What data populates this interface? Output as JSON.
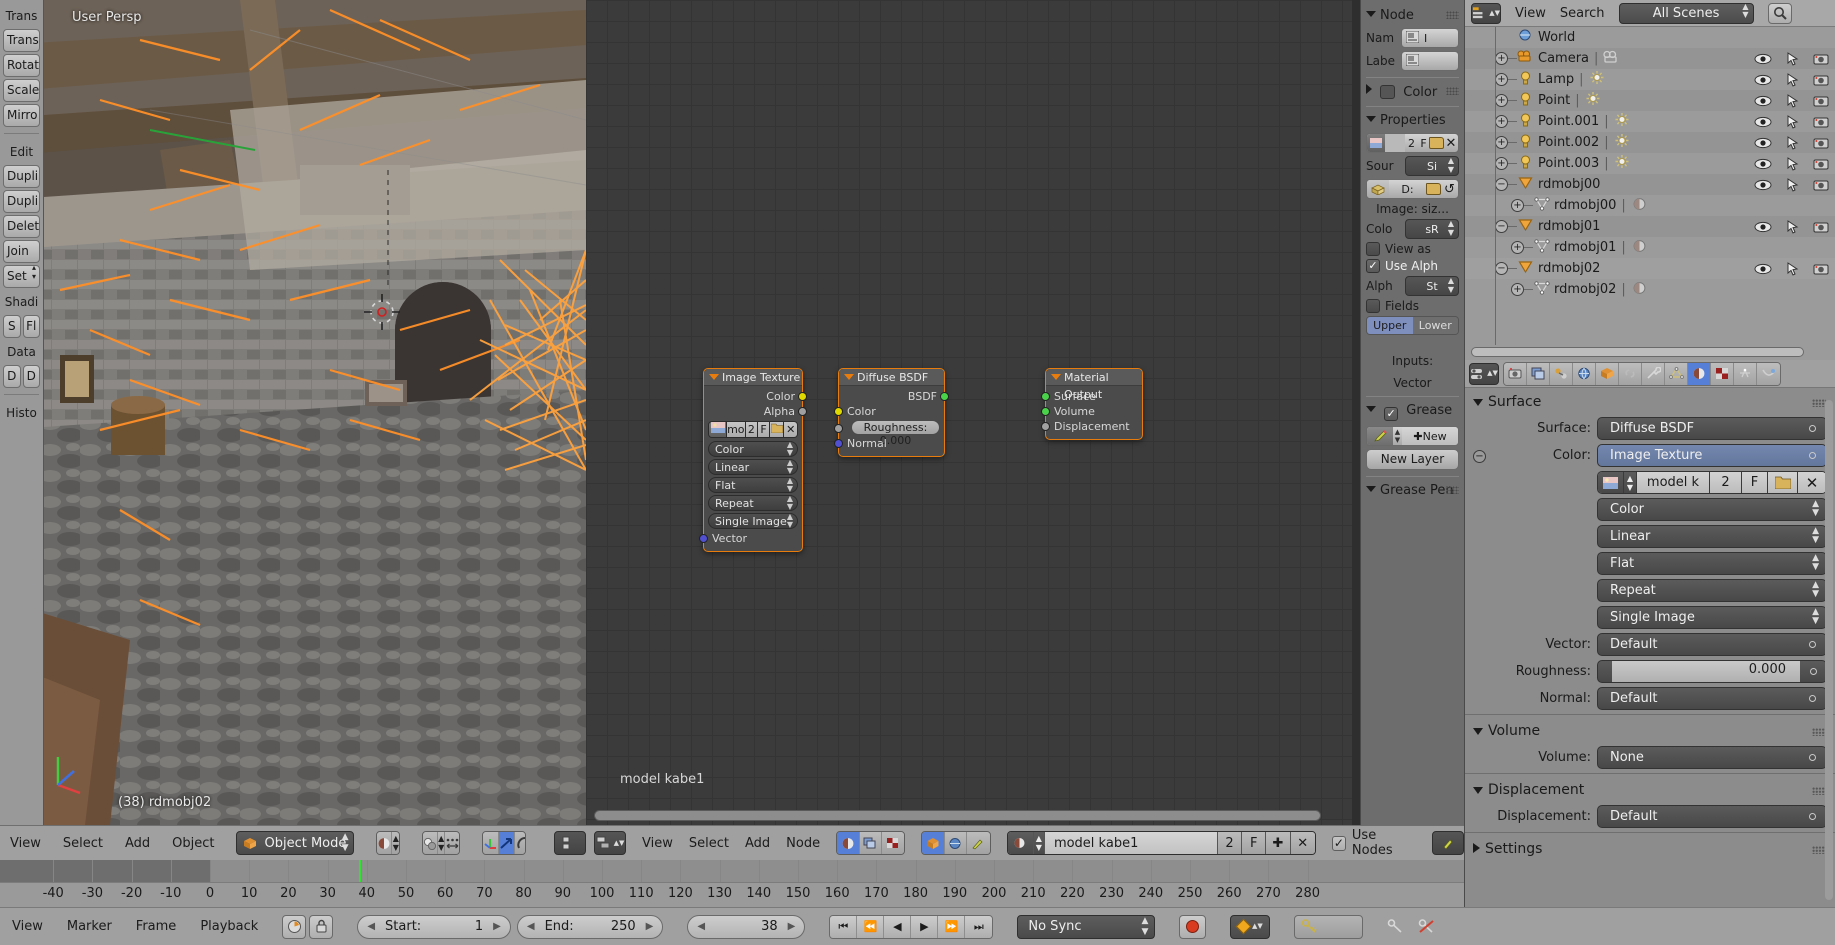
{
  "viewport": {
    "persp_label": "User Persp",
    "object_label": "(38) rdmobj02",
    "toolshelf": {
      "section1_title": "Trans",
      "buttons1": [
        "Trans",
        "Rotat",
        "Scale",
        "Mirro"
      ],
      "section2_title": "Edit",
      "buttons2": [
        "Dupli",
        "Dupli",
        "Delet",
        "Join"
      ],
      "set_button": "Set",
      "shading_title": "Shadi",
      "shading_row": [
        "S",
        "Fl"
      ],
      "data_title": "Data",
      "data_row": [
        "D",
        "D"
      ],
      "history_title": "Histo"
    }
  },
  "node_editor": {
    "footer_label": "model kabe1",
    "nodes": [
      {
        "title": "Image Texture",
        "outputs": [
          "Color",
          "Alpha"
        ],
        "image_row": {
          "name": "mo",
          "users": "2",
          "fake": "F"
        },
        "dropdowns": [
          "Color",
          "Linear",
          "Flat",
          "Repeat",
          "Single Image"
        ],
        "inputs": [
          "Vector"
        ]
      },
      {
        "title": "Diffuse BSDF",
        "outputs": [
          "BSDF"
        ],
        "inputs": [
          "Color",
          "Normal"
        ],
        "roughness": "Roughness: 0.000"
      },
      {
        "title": "Material Output",
        "inputs": [
          "Surface",
          "Volume",
          "Displacement"
        ]
      }
    ]
  },
  "node_panel": {
    "node_header": "Node",
    "name_label": "Nam",
    "label_label": "Labe",
    "color_label": "Color",
    "properties_header": "Properties",
    "image_row": {
      "users": "2",
      "fake": "F"
    },
    "source_label": "Sour",
    "source_value": "Si",
    "pack_label": "D:",
    "image_size_label": "Image: siz...",
    "color_label2": "Colo",
    "color_value": "sR",
    "view_as_label": "View as",
    "use_alpha_label": "Use Alph",
    "alpha_label": "Alph",
    "alpha_value": "St",
    "fields_label": "Fields",
    "field_upper": "Upper",
    "field_lower": "Lower",
    "inputs_label": "Inputs:",
    "vector_label": "Vector",
    "grease_header": "Grease",
    "new_button": "New",
    "new_layer_button": "New Layer",
    "grease_pen_header": "Grease Pen"
  },
  "outliner": {
    "menus": [
      "View",
      "Search"
    ],
    "scene_selector": "All Scenes",
    "rows": [
      {
        "name": "World",
        "icon": "world-icon",
        "indent": 1,
        "expand": "",
        "selected": false,
        "partial": true
      },
      {
        "name": "Camera",
        "icon": "camera-icon",
        "indent": 1,
        "expand": "+",
        "selected": false,
        "sub": "camera-data-icon"
      },
      {
        "name": "Lamp",
        "icon": "lamp-icon",
        "indent": 1,
        "expand": "+",
        "selected": false,
        "sub": "lamp-data-icon"
      },
      {
        "name": "Point",
        "icon": "lamp-icon",
        "indent": 1,
        "expand": "+",
        "selected": false,
        "sub": "lamp-data-icon"
      },
      {
        "name": "Point.001",
        "icon": "lamp-icon",
        "indent": 1,
        "expand": "+",
        "selected": false,
        "sub": "lamp-data-icon"
      },
      {
        "name": "Point.002",
        "icon": "lamp-icon",
        "indent": 1,
        "expand": "+",
        "selected": false,
        "sub": "lamp-data-icon"
      },
      {
        "name": "Point.003",
        "icon": "lamp-icon",
        "indent": 1,
        "expand": "+",
        "selected": false,
        "sub": "lamp-data-icon"
      },
      {
        "name": "rdmobj00",
        "icon": "mesh-object-icon",
        "indent": 1,
        "expand": "−",
        "selected": false
      },
      {
        "name": "rdmobj00",
        "icon": "mesh-data-icon",
        "indent": 2,
        "expand": "+",
        "selected": false,
        "sub": "material-icon"
      },
      {
        "name": "rdmobj01",
        "icon": "mesh-object-icon",
        "indent": 1,
        "expand": "−",
        "selected": false
      },
      {
        "name": "rdmobj01",
        "icon": "mesh-data-icon",
        "indent": 2,
        "expand": "+",
        "selected": false,
        "sub": "material-icon"
      },
      {
        "name": "rdmobj02",
        "icon": "mesh-object-icon",
        "indent": 1,
        "expand": "−",
        "selected": true
      },
      {
        "name": "rdmobj02",
        "icon": "mesh-data-icon",
        "indent": 2,
        "expand": "+",
        "selected": false,
        "sub": "material-icon"
      }
    ]
  },
  "properties": {
    "tabs": [
      "render-icon",
      "render-layers-icon",
      "scene-icon",
      "world-icon",
      "object-icon",
      "constraints-icon",
      "modifiers-icon",
      "data-icon",
      "material-icon",
      "texture-icon",
      "particles-icon",
      "physics-icon"
    ],
    "active_tab_index": 8,
    "surface_header": "Surface",
    "surface_label": "Surface:",
    "surface_value": "Diffuse BSDF",
    "color_label": "Color:",
    "color_value": "Image Texture",
    "image_row": {
      "name": "model  k",
      "users": "2",
      "fake": "F"
    },
    "dropdowns": [
      "Color",
      "Linear",
      "Flat",
      "Repeat",
      "Single Image"
    ],
    "vector_label": "Vector:",
    "vector_value": "Default",
    "roughness_label": "Roughness:",
    "roughness_value": "0.000",
    "normal_label": "Normal:",
    "normal_value": "Default",
    "volume_header": "Volume",
    "volume_label": "Volume:",
    "volume_value": "None",
    "displacement_header": "Displacement",
    "displacement_label": "Displacement:",
    "displacement_value": "Default",
    "settings_header": "Settings"
  },
  "viewport_header": {
    "menus": [
      "View",
      "Select",
      "Add",
      "Object"
    ],
    "mode": "Object Mode"
  },
  "node_header": {
    "menus": [
      "View",
      "Select",
      "Add",
      "Node"
    ],
    "material_name": "model kabe1",
    "users": "2",
    "fake_user": "F",
    "use_nodes_label": "Use Nodes"
  },
  "timeline": {
    "ticks": [
      "-40",
      "-30",
      "-20",
      "-10",
      "0",
      "10",
      "20",
      "30",
      "40",
      "50",
      "60",
      "70",
      "80",
      "90",
      "100",
      "110",
      "120",
      "130",
      "140",
      "150",
      "160",
      "170",
      "180",
      "190",
      "200",
      "210",
      "220",
      "230",
      "240",
      "250",
      "260",
      "270",
      "280"
    ],
    "playhead_frame": 38
  },
  "statusbar": {
    "menus": [
      "View",
      "Marker",
      "Frame",
      "Playback"
    ],
    "start_label": "Start:",
    "start_value": "1",
    "end_label": "End:",
    "end_value": "250",
    "current_frame": "38",
    "sync_mode": "No Sync"
  }
}
